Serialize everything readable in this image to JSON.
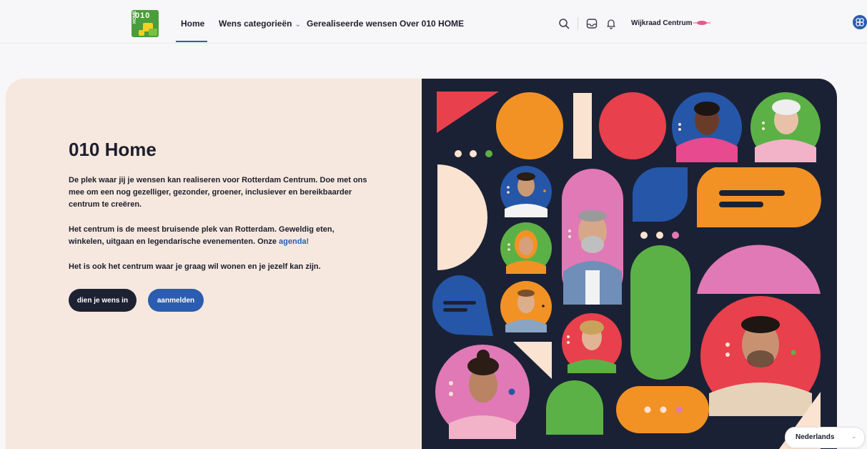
{
  "header": {
    "logo": {
      "top_text": "010",
      "side_text": "HOME"
    },
    "nav": [
      {
        "label": "Home",
        "active": true
      },
      {
        "label": "Wens categorieën",
        "has_dropdown": true
      },
      {
        "label": "Gerealiseerde wensen"
      },
      {
        "label": "Over 010 HOME"
      }
    ],
    "icons": [
      "search-icon",
      "inbox-icon",
      "bell-icon"
    ],
    "user_label": "Wijkraad Centrum",
    "accessibility_icon": "accessibility-icon"
  },
  "hero": {
    "title": "010 Home",
    "paragraph_1": "De plek waar jij je wensen kan realiseren voor Rotterdam Centrum. Doe met ons mee om een nog gezelliger, gezonder, groener, inclusiever en bereikbaarder centrum te creëren.",
    "paragraph_2_text": "Het centrum is de meest bruisende plek van Rotterdam. Geweldig eten, winkelen, uitgaan en legendarische evenementen. Onze",
    "paragraph_2_link": "agenda!",
    "paragraph_3": "Het is ook het centrum waar je graag wil wonen en je jezelf kan zijn.",
    "primary_button": "dien je wens in",
    "secondary_button": "aanmelden"
  },
  "language_selector": {
    "value": "Nederlands"
  },
  "colors": {
    "brand_blue": "#2a5db0",
    "dark_navy": "#1b2134",
    "hero_bg": "#f6e8de",
    "accent_red": "#e8404c",
    "accent_orange": "#f39224",
    "accent_pink": "#e079b6",
    "accent_green": "#5cb146",
    "accent_blue": "#2556a8",
    "cream": "#fbe3d2"
  }
}
